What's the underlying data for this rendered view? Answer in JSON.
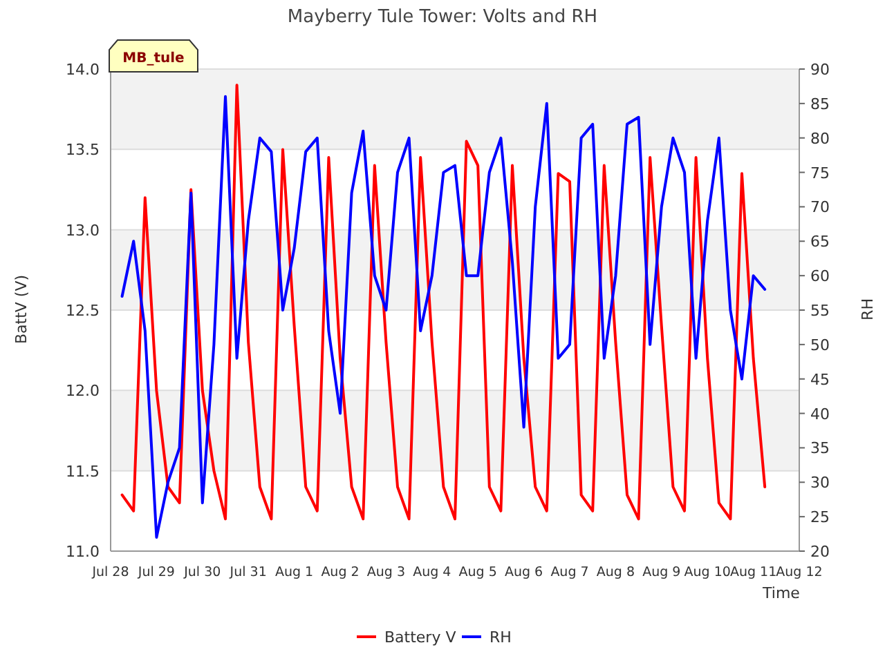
{
  "tag": "MB_tule",
  "chart_data": {
    "type": "line",
    "title": "Mayberry Tule Tower: Volts and RH",
    "xlabel": "Time",
    "ylabel": "BattV (V)",
    "y2label": "RH",
    "categories": [
      "Jul 28",
      null,
      null,
      null,
      "Jul 29",
      null,
      null,
      null,
      "Jul 30",
      null,
      null,
      null,
      "Jul 31",
      null,
      null,
      null,
      "Aug 1",
      null,
      null,
      null,
      "Aug 2",
      null,
      null,
      null,
      "Aug 3",
      null,
      null,
      null,
      "Aug 4",
      null,
      null,
      null,
      "Aug 5",
      null,
      null,
      null,
      "Aug 6",
      null,
      null,
      null,
      "Aug 7",
      null,
      null,
      null,
      "Aug 8",
      null,
      null,
      null,
      "Aug 9",
      null,
      null,
      null,
      "Aug 10",
      null,
      null,
      null,
      "Aug 11",
      null,
      null,
      null,
      "Aug 12"
    ],
    "grid": true,
    "legend": "bottom",
    "ylim": [
      11,
      14
    ],
    "yticks": [
      {
        "value": 11,
        "label": "11.0"
      },
      {
        "value": 11.5,
        "label": "11.5"
      },
      {
        "value": 12,
        "label": "12.0"
      },
      {
        "value": 12.5,
        "label": "12.5"
      },
      {
        "value": 13,
        "label": "13.0"
      },
      {
        "value": 13.5,
        "label": "13.5"
      },
      {
        "value": 14,
        "label": "14.0"
      }
    ],
    "y2lim": [
      20,
      90
    ],
    "y2ticks": [
      20,
      25,
      30,
      35,
      40,
      45,
      50,
      55,
      60,
      65,
      70,
      75,
      80,
      85,
      90
    ],
    "series": [
      {
        "name": "Battery V",
        "color": "#ff0000",
        "axis": "y",
        "values": [
          null,
          11.35,
          11.25,
          13.2,
          12.0,
          11.4,
          11.3,
          13.25,
          12.0,
          11.5,
          11.2,
          13.9,
          12.3,
          11.4,
          11.2,
          13.5,
          12.4,
          11.4,
          11.25,
          13.45,
          12.2,
          11.4,
          11.2,
          13.4,
          12.3,
          11.4,
          11.2,
          13.45,
          12.3,
          11.4,
          11.2,
          13.55,
          13.4,
          11.4,
          11.25,
          13.4,
          12.2,
          11.4,
          11.25,
          13.35,
          13.3,
          11.35,
          11.25,
          13.4,
          12.3,
          11.35,
          11.2,
          13.45,
          12.4,
          11.4,
          11.25,
          13.45,
          12.2,
          11.3,
          11.2,
          13.35,
          12.2,
          11.4,
          null,
          null,
          null
        ]
      },
      {
        "name": "RH",
        "color": "#0000ff",
        "axis": "y2",
        "values": [
          null,
          57,
          65,
          52,
          22,
          30,
          35,
          72,
          27,
          50,
          86,
          48,
          68,
          80,
          78,
          55,
          64,
          78,
          80,
          52,
          40,
          72,
          81,
          60,
          55,
          75,
          80,
          52,
          60,
          75,
          76,
          60,
          60,
          75,
          80,
          62,
          38,
          70,
          85,
          48,
          50,
          80,
          82,
          48,
          60,
          82,
          83,
          50,
          70,
          80,
          75,
          48,
          68,
          80,
          55,
          45,
          60,
          58,
          null,
          null,
          null
        ]
      }
    ]
  }
}
